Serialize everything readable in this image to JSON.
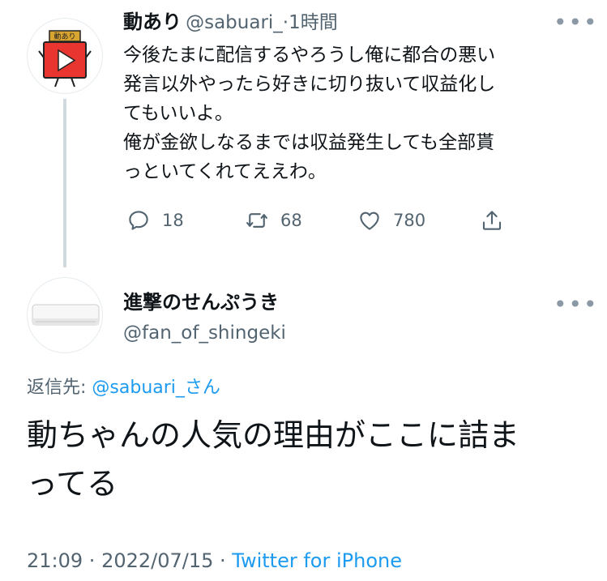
{
  "tweet1": {
    "display_name": "動あり",
    "handle": "@sabuari_",
    "separator": "·",
    "time": "1時間",
    "text": "今後たまに配信するやろうし俺に都合の悪い\n発言以外やったら好きに切り抜いて収益化し\nてもいいよ。\n俺が金欲しなるまでは収益発生しても全部貰\nっといてくれてええわ。",
    "avatar_label": "動あり",
    "replies": "18",
    "retweets": "68",
    "likes": "780"
  },
  "tweet2": {
    "display_name": "進撃のせんぷうき",
    "handle": "@fan_of_shingeki",
    "reply_prefix": "返信先: ",
    "reply_mention": "@sabuari_さん",
    "text": "動ちゃんの人気の理由がここに詰ま\nってる",
    "time": "21:09",
    "sep1": " · ",
    "date": "2022/07/15",
    "sep2": " · ",
    "source": "Twitter for iPhone"
  },
  "icons": {
    "reply": "reply-icon",
    "retweet": "retweet-icon",
    "like": "heart-icon",
    "share": "share-icon",
    "more": "more-icon"
  },
  "colors": {
    "accent": "#1d9bf0",
    "secondary_text": "#536471",
    "logo_red": "#e8352f",
    "logo_gold": "#d9a531"
  }
}
